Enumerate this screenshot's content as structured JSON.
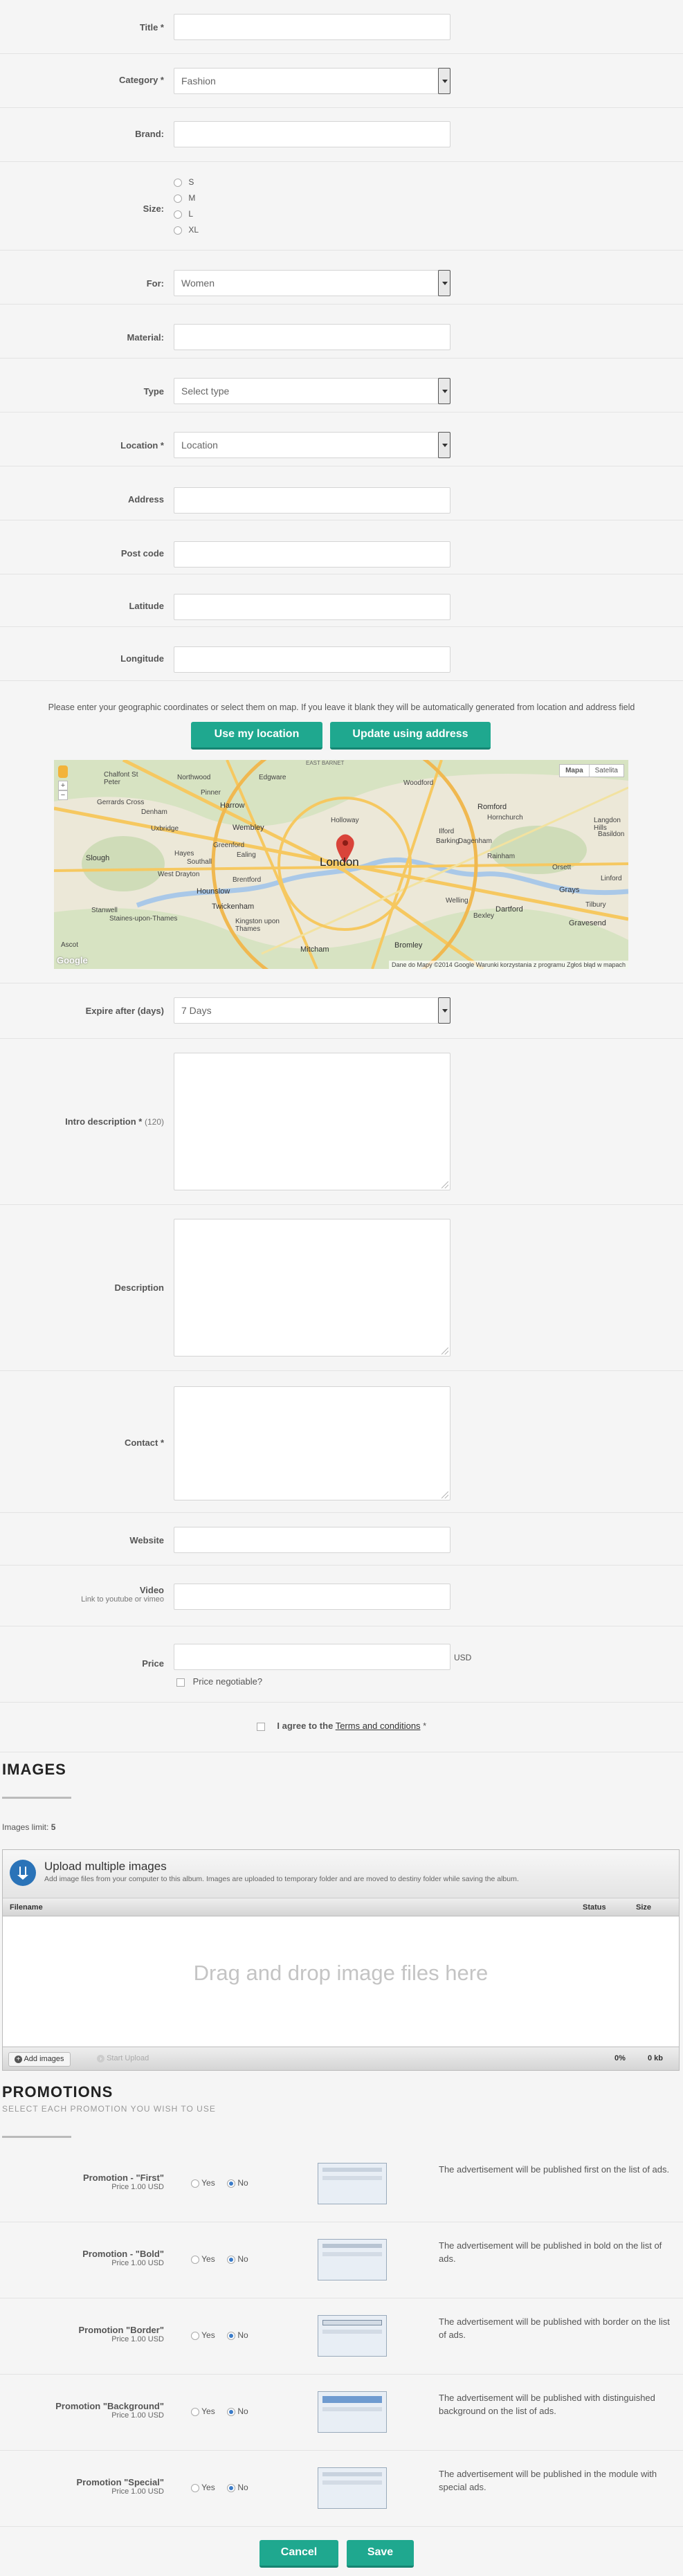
{
  "form": {
    "title_label": "Title *",
    "title_value": "",
    "category_label": "Category *",
    "category_value": "Fashion",
    "brand_label": "Brand:",
    "brand_value": "",
    "size_label": "Size:",
    "size_options": [
      "S",
      "M",
      "L",
      "XL"
    ],
    "for_label": "For:",
    "for_value": "Women",
    "material_label": "Material:",
    "type_label": "Type",
    "type_value": "Select type",
    "location_label": "Location *",
    "location_value": "Location",
    "address_label": "Address",
    "postcode_label": "Post code",
    "latitude_label": "Latitude",
    "longitude_label": "Longitude"
  },
  "geo": {
    "hint": "Please enter your geographic coordinates or select them on map. If you leave it blank they will be automatically generated from location and address field",
    "use_location_btn": "Use my location",
    "update_address_btn": "Update using address"
  },
  "map": {
    "type_map": "Mapa",
    "type_satellite": "Satelita",
    "pin_label": "London",
    "google_logo": "Google",
    "footer": "Dane do Mapy ©2014 Google  Warunki korzystania z programu  Zgłoś błąd w mapach",
    "places": [
      "Chalfont St Peter",
      "Northwood",
      "Edgware",
      "EAST BARNET",
      "Woodford",
      "Romford",
      "Hornchurch",
      "Harrow",
      "Wembley",
      "Gerrards Cross",
      "Denham",
      "Uxbridge",
      "Pinner",
      "Holloway",
      "Ilford",
      "Barking",
      "Dagenham",
      "Slough",
      "Hayes",
      "Southall",
      "Greenford",
      "Ealing",
      "Brentford",
      "Hounslow",
      "Twickenham",
      "Kingston upon Thames",
      "Mitcham",
      "Bromley",
      "Welling",
      "Bexley",
      "Dartford",
      "Grays",
      "Tilbury",
      "Gravesend",
      "Rainham",
      "Stanwell",
      "Staines-upon-Thames",
      "Ascot",
      "West Drayton",
      "Langdon Hills",
      "Basildon",
      "Linford",
      "Orsett"
    ]
  },
  "expire": {
    "label": "Expire after (days)",
    "value": "7 Days"
  },
  "intro": {
    "label": "Intro description *",
    "count": "(120)"
  },
  "description": {
    "label": "Description"
  },
  "contact": {
    "label": "Contact *"
  },
  "website": {
    "label": "Website"
  },
  "video": {
    "label": "Video",
    "sublabel": "Link to youtube or vimeo"
  },
  "price": {
    "label": "Price",
    "currency": "USD",
    "negotiable": "Price negotiable?"
  },
  "agree": {
    "text": "I agree to the",
    "link": "Terms and conditions",
    "req": "*"
  },
  "images": {
    "title": "IMAGES",
    "limit_label": "Images limit:",
    "limit_value": "5",
    "upload_title": "Upload multiple images",
    "upload_desc": "Add image files from your computer to this album. Images are uploaded to temporary folder and are moved to destiny folder while saving the album.",
    "col_filename": "Filename",
    "col_status": "Status",
    "col_size": "Size",
    "drop_text": "Drag and drop image files here",
    "add_btn": "Add images",
    "start_btn": "Start Upload",
    "percent": "0%",
    "total_size": "0 kb"
  },
  "promotions": {
    "title": "PROMOTIONS",
    "subtitle": "SELECT EACH PROMOTION YOU WISH TO USE",
    "yes": "Yes",
    "no": "No",
    "items": [
      {
        "name": "Promotion - \"First\"",
        "price": "Price 1.00 USD",
        "desc": "The advertisement will be published first on the list of ads."
      },
      {
        "name": "Promotion - \"Bold\"",
        "price": "Price 1.00 USD",
        "desc": "The advertisement will be published in bold on the list of ads."
      },
      {
        "name": "Promotion \"Border\"",
        "price": "Price 1.00 USD",
        "desc": "The advertisement will be published with border on the list of ads."
      },
      {
        "name": "Promotion \"Background\"",
        "price": "Price 1.00 USD",
        "desc": "The advertisement will be published with distinguished background on the list of ads."
      },
      {
        "name": "Promotion \"Special\"",
        "price": "Price 1.00 USD",
        "desc": "The advertisement will be published in the module with special ads."
      }
    ]
  },
  "actions": {
    "cancel": "Cancel",
    "save": "Save"
  },
  "colors": {
    "accent": "#1fa88f",
    "upload_header": "#2a73b8"
  }
}
